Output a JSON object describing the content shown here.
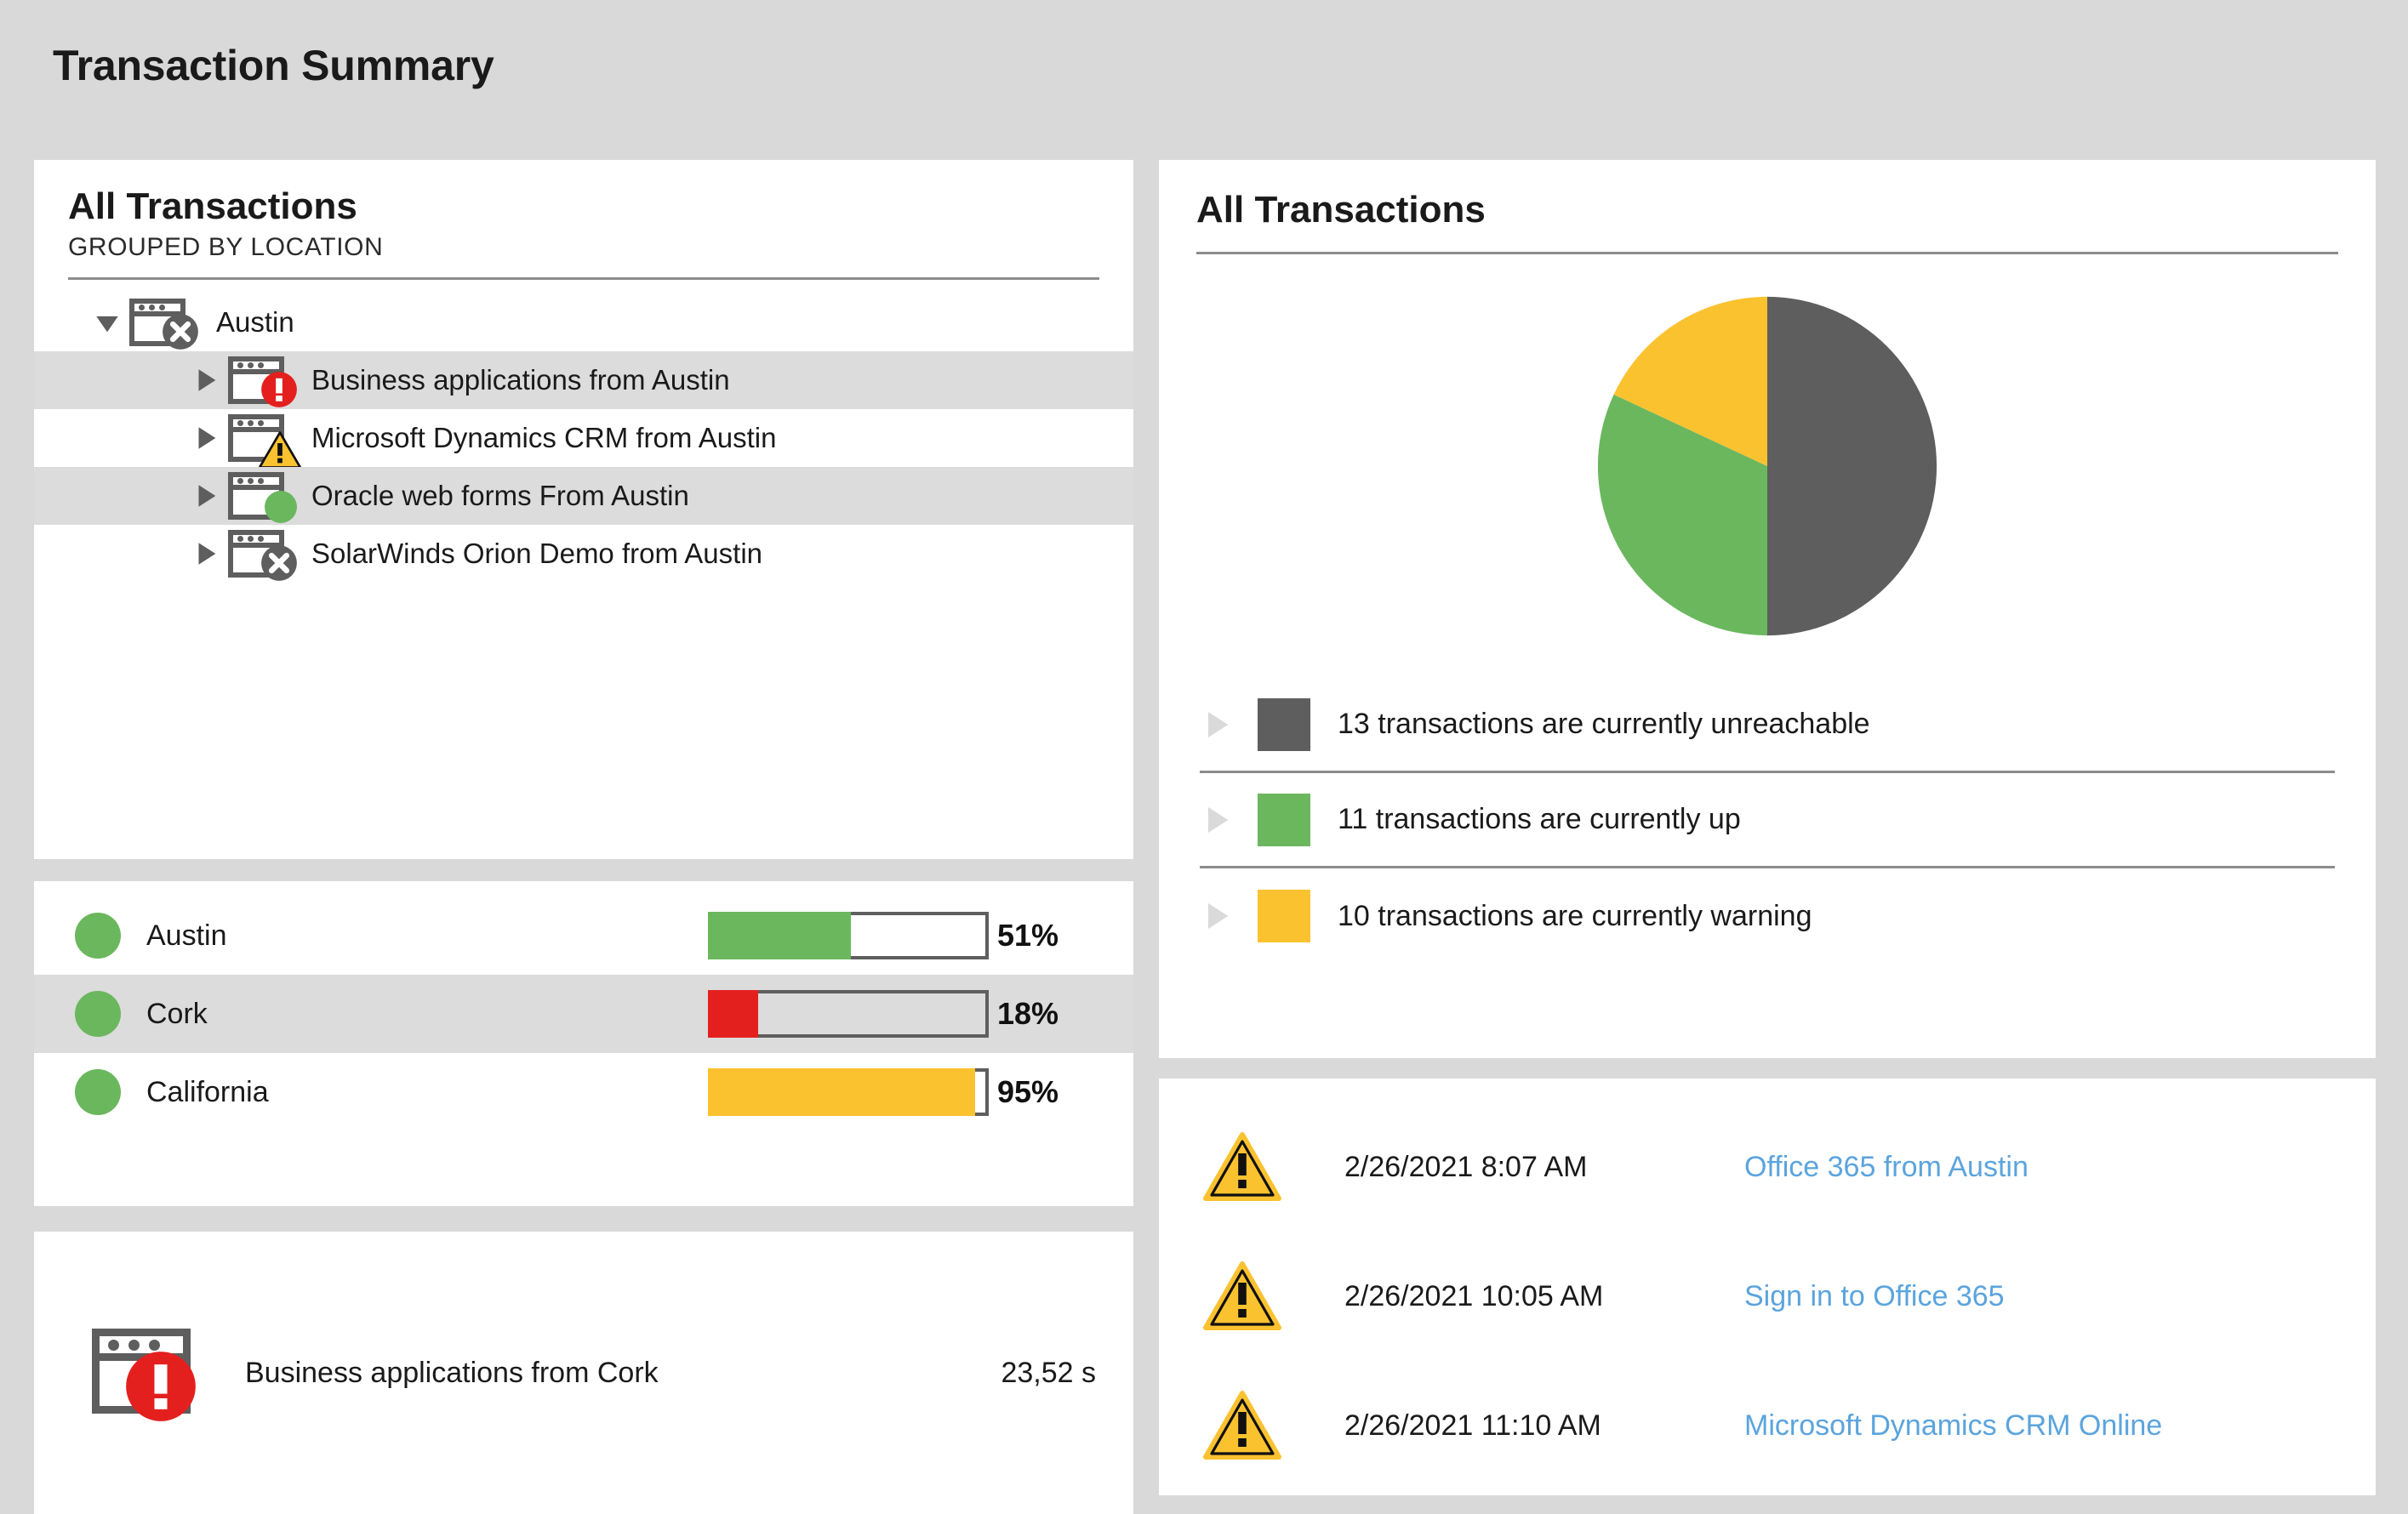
{
  "header": {
    "title": "Transaction Summary"
  },
  "colors": {
    "page_bg": "#d9d9d9",
    "panel_bg": "#ffffff",
    "gray": "#5e5e5e",
    "green": "#6bb75e",
    "yellow": "#fbc230",
    "red": "#e4201f",
    "link_blue": "#5ba4dd",
    "row_alt": "#dcdcdc",
    "rule": "#8c8c8c"
  },
  "tree_panel": {
    "title": "All Transactions",
    "subtitle": "GROUPED BY LOCATION",
    "rows": [
      {
        "label": "Austin",
        "level": "group",
        "caret": "caret-down-icon",
        "status": "unreachable",
        "icon": "browser-window-icon",
        "alt": false
      },
      {
        "label": "Business applications from Austin",
        "level": "child",
        "caret": "caret-right-icon",
        "status": "critical",
        "icon": "browser-window-icon",
        "alt": true
      },
      {
        "label": "Microsoft Dynamics CRM from Austin",
        "level": "child",
        "caret": "caret-right-icon",
        "status": "warning",
        "icon": "browser-window-icon",
        "alt": false
      },
      {
        "label": "Oracle web forms From Austin",
        "level": "child",
        "caret": "caret-right-icon",
        "status": "up",
        "icon": "browser-window-icon",
        "alt": true
      },
      {
        "label": "SolarWinds Orion Demo from Austin",
        "level": "child",
        "caret": "caret-right-icon",
        "status": "unreachable",
        "icon": "browser-window-icon",
        "alt": false
      }
    ]
  },
  "locations_panel": {
    "rows": [
      {
        "name": "Austin",
        "percent": 51,
        "percent_label": "51%",
        "bar_color": "#6bb75e",
        "dot_color": "#6bb75e",
        "alt": false
      },
      {
        "name": "Cork",
        "percent": 18,
        "percent_label": "18%",
        "bar_color": "#e4201f",
        "dot_color": "#6bb75e",
        "alt": true
      },
      {
        "name": "California",
        "percent": 95,
        "percent_label": "95%",
        "bar_color": "#fbc230",
        "dot_color": "#6bb75e",
        "alt": false
      }
    ]
  },
  "slowest_panel": {
    "name": "Business applications from Cork",
    "value": "23,52 s",
    "icon": "browser-window-icon",
    "status": "critical"
  },
  "pie_panel": {
    "title": "All Transactions"
  },
  "chart_data": {
    "type": "pie",
    "title": "All Transactions",
    "labels": [
      "13 transactions are currently unreachable",
      "11 transactions are currently up",
      "10 transactions are currently warning"
    ],
    "short_labels": [
      "unreachable",
      "up",
      "warning"
    ],
    "values": [
      13,
      11,
      10
    ],
    "counts": [
      13,
      11,
      10
    ],
    "colors": [
      "#5e5e5e",
      "#6bb75e",
      "#fbc230"
    ],
    "slice_angles_deg": [
      180,
      115,
      65
    ],
    "start_angle_deg": 0,
    "legend_position": "bottom",
    "grid": false
  },
  "alerts_panel": {
    "rows": [
      {
        "icon": "warning-triangle-icon",
        "timestamp": "2/26/2021  8:07 AM",
        "link": "Office 365 from Austin"
      },
      {
        "icon": "warning-triangle-icon",
        "timestamp": "2/26/2021  10:05 AM",
        "link": "Sign in to Office 365"
      },
      {
        "icon": "warning-triangle-icon",
        "timestamp": "2/26/2021  11:10 AM",
        "link": "Microsoft Dynamics CRM Online"
      }
    ]
  }
}
